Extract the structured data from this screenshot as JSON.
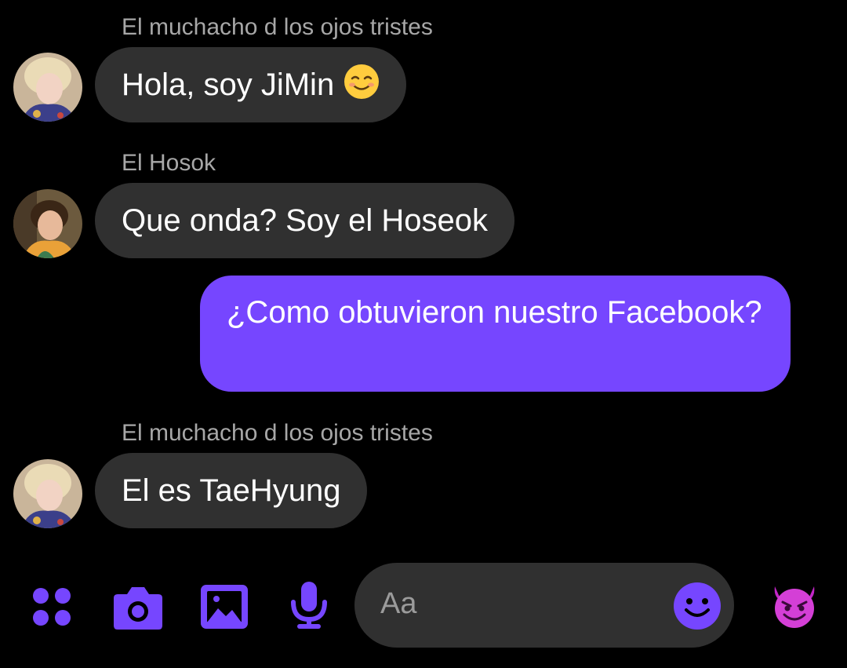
{
  "messages": [
    {
      "sender": "El muchacho d los ojos tristes",
      "text": "Hola, soy JiMin",
      "emoji": "smiling-face"
    },
    {
      "sender": "El Hosok",
      "text": "Que onda? Soy el Hoseok"
    },
    {
      "outgoing": true,
      "text": "¿Como obtuvieron nuestro Facebook?"
    },
    {
      "sender": "El muchacho d los ojos tristes",
      "text": "El es TaeHyung"
    }
  ],
  "composer": {
    "placeholder": "Aa",
    "icons": [
      "grid-menu-icon",
      "camera-icon",
      "gallery-icon",
      "microphone-icon",
      "emoji-icon",
      "devil-emoji-icon"
    ]
  },
  "colors": {
    "background": "#000000",
    "incoming_bubble": "#303030",
    "outgoing_bubble": "#7646ff",
    "accent": "#7646ff",
    "sender_name": "#a7a7a7"
  }
}
